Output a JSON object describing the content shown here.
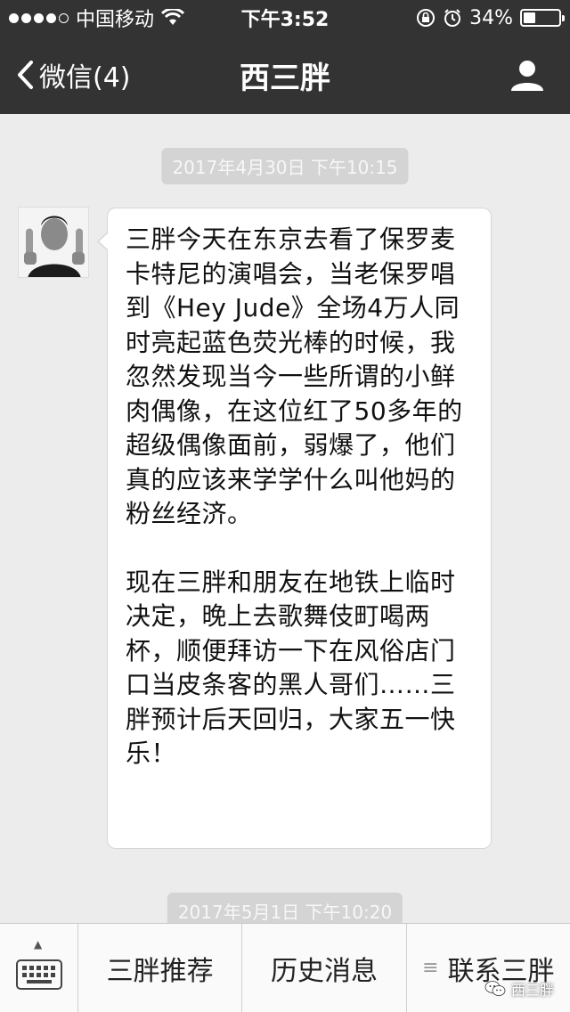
{
  "status_bar": {
    "carrier": "中国移动",
    "time": "下午3:52",
    "battery_percent": "34%",
    "battery_level": 0.34,
    "icons": [
      "signal-dots-icon",
      "wifi-icon",
      "rotation-lock-icon",
      "alarm-icon",
      "battery-icon"
    ]
  },
  "nav": {
    "back_label": "微信(4)",
    "title": "西三胖",
    "right_icon": "profile-icon",
    "background": "#333333"
  },
  "chat": {
    "timestamps": [
      "2017年4月30日 下午10:15",
      "2017年5月1日 下午10:20"
    ],
    "message": {
      "paragraphs": [
        "三胖今天在东京去看了保罗麦卡特尼的演唱会，当老保罗唱到《Hey Jude》全场4万人同时亮起蓝色荧光棒的时候，我忽然发现当今一些所谓的小鲜肉偶像，在这位红了50多年的超级偶像面前，弱爆了，他们真的应该来学学什么叫他妈的粉丝经济。",
        "现在三胖和朋友在地铁上临时决定，晚上去歌舞伎町喝两杯，顺便拜访一下在风俗店门口当皮条客的黑人哥们……三胖预计后天回归，大家五一快乐！"
      ]
    }
  },
  "bottom_menu": {
    "keyboard_icon": "keyboard-icon",
    "items": [
      "三胖推荐",
      "历史消息",
      "联系三胖"
    ],
    "third_item_icon": "list-icon"
  },
  "watermark": {
    "text": "西三胖",
    "icon": "wechat-icon"
  }
}
